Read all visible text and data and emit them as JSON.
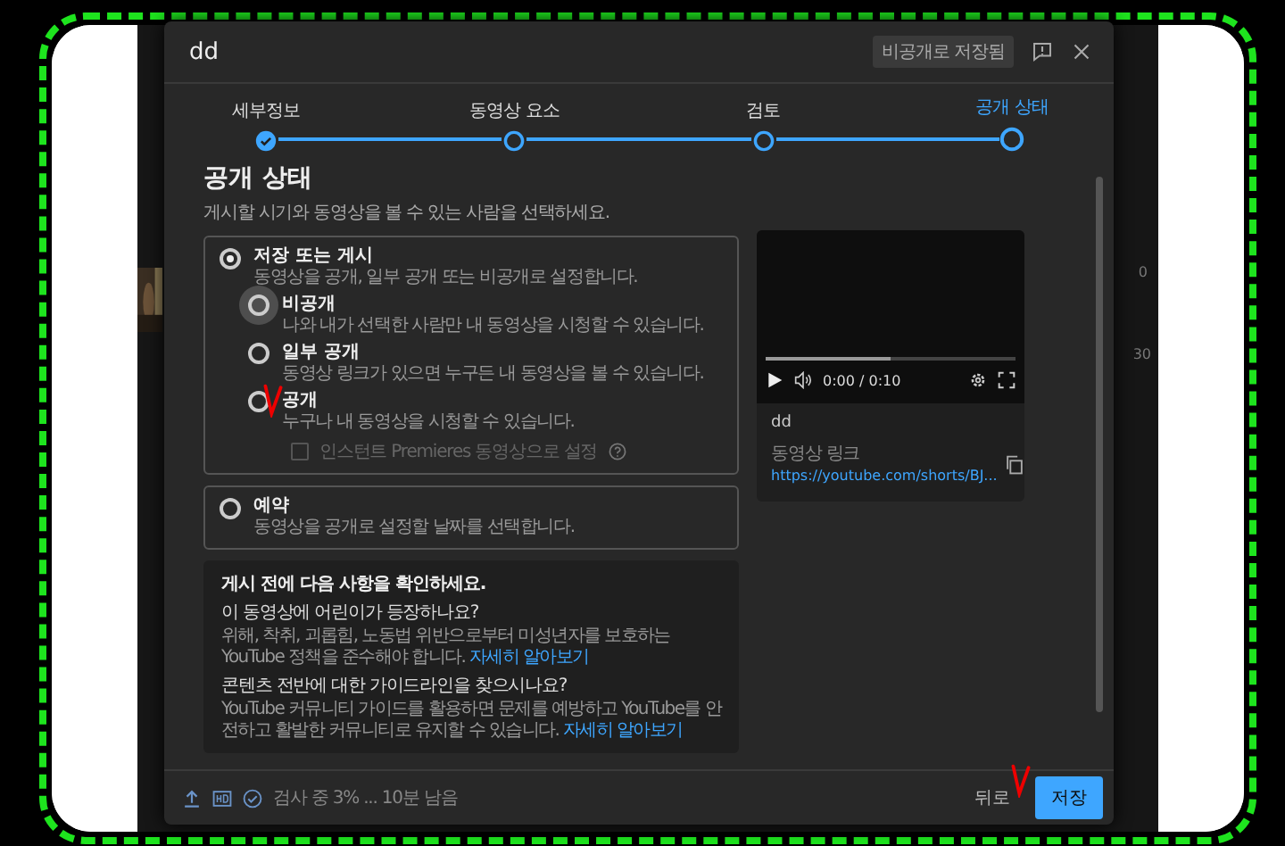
{
  "background_page": {
    "cells": [
      "0",
      "30"
    ]
  },
  "dialog": {
    "title": "dd",
    "save_status": "비공개로 저장됨"
  },
  "steps": [
    {
      "label": "세부정보",
      "done": true,
      "selected": false
    },
    {
      "label": "동영상 요소",
      "done": false,
      "selected": false
    },
    {
      "label": "검토",
      "done": false,
      "selected": false
    },
    {
      "label": "공개 상태",
      "done": false,
      "selected": true
    }
  ],
  "section": {
    "title": "공개 상태",
    "subtitle": "게시할 시기와 동영상을 볼 수 있는 사람을 선택하세요."
  },
  "publish_option": {
    "label": "저장 또는 게시",
    "description": "동영상을 공개, 일부 공개 또는 비공개로 설정합니다.",
    "selected": true,
    "visibility": [
      {
        "label": "비공개",
        "description": "나와 내가 선택한 사람만 내 동영상을 시청할 수 있습니다.",
        "selected": false,
        "hovered": true
      },
      {
        "label": "일부 공개",
        "description": "동영상 링크가 있으면 누구든 내 동영상을 볼 수 있습니다.",
        "selected": false,
        "hovered": false
      },
      {
        "label": "공개",
        "description": "누구나 내 동영상을 시청할 수 있습니다.",
        "selected": false,
        "hovered": false
      }
    ],
    "premiere": {
      "label": "인스턴트 Premieres 동영상으로 설정",
      "checked": false,
      "disabled": true
    }
  },
  "schedule_option": {
    "label": "예약",
    "description": "동영상을 공개로 설정할 날짜를 선택합니다.",
    "selected": false
  },
  "notice": {
    "title": "게시 전에 다음 사항을 확인하세요.",
    "items": [
      {
        "question": "이 동영상에 어린이가 등장하나요?",
        "text": "위해, 착취, 괴롭힘, 노동법 위반으로부터 미성년자를 보호하는 YouTube 정책을 준수해야 합니다.",
        "link": "자세히 알아보기"
      },
      {
        "question": "콘텐츠 전반에 대한 가이드라인을 찾으시나요?",
        "text": "YouTube 커뮤니티 가이드를 활용하면 문제를 예방하고 YouTube를 안전하고 활발한 커뮤니티로 유지할 수 있습니다.",
        "link": "자세히 알아보기"
      }
    ]
  },
  "preview": {
    "time": "0:00 / 0:10",
    "level": 0.5,
    "title": "dd",
    "link_label": "동영상 링크",
    "link": "https://youtube.com/shorts/BJ..."
  },
  "footer": {
    "status": "검사 중 3% ... 10분 남음",
    "buttons": [
      {
        "label": "뒤로",
        "kind": "text"
      },
      {
        "label": "저장",
        "kind": "primary"
      }
    ]
  }
}
